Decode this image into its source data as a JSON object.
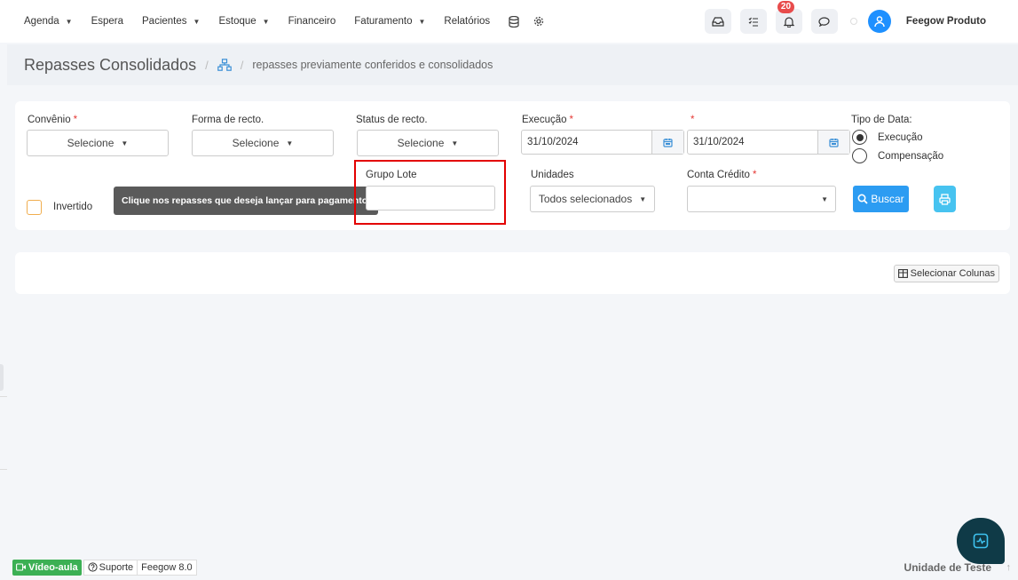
{
  "nav": {
    "items": [
      {
        "label": "Agenda",
        "dropdown": true
      },
      {
        "label": "Espera",
        "dropdown": false
      },
      {
        "label": "Pacientes",
        "dropdown": true
      },
      {
        "label": "Estoque",
        "dropdown": true
      },
      {
        "label": "Financeiro",
        "dropdown": false
      },
      {
        "label": "Faturamento",
        "dropdown": true
      },
      {
        "label": "Relatórios",
        "dropdown": false
      }
    ],
    "notification_count": "20",
    "user_name": "Feegow Produto"
  },
  "header": {
    "title": "Repasses Consolidados",
    "separator": "/",
    "breadcrumb": "repasses previamente conferidos e consolidados"
  },
  "filters": {
    "convenio_label": "Convênio",
    "convenio_value": "Selecione",
    "forma_label": "Forma de recto.",
    "forma_value": "Selecione",
    "status_label": "Status de recto.",
    "status_value": "Selecione",
    "execucao_label": "Execução",
    "date_from": "31/10/2024",
    "date_to": "31/10/2024",
    "required_mark": "*",
    "tipo_data_label": "Tipo de Data:",
    "tipo_options": [
      {
        "label": "Execução",
        "selected": true
      },
      {
        "label": "Compensação",
        "selected": false
      }
    ],
    "invertido_label": "Invertido",
    "tooltip": "Clique nos repasses que deseja lançar para pagamento.",
    "grupo_lote_label": "Grupo Lote",
    "grupo_lote_value": "",
    "unidades_label": "Unidades",
    "unidades_value": "Todos selecionados",
    "conta_label": "Conta Crédito",
    "conta_value": "",
    "buscar_label": "Buscar"
  },
  "results": {
    "select_columns_label": "Selecionar Colunas"
  },
  "footer": {
    "video_label": "Vídeo-aula",
    "support_label": "Suporte",
    "version": "Feegow 8.0",
    "unit": "Unidade de Teste"
  },
  "colors": {
    "accent": "#2c9cf2",
    "highlight": "#e30000",
    "badge": "#e84c4c",
    "required": "#e53935"
  }
}
